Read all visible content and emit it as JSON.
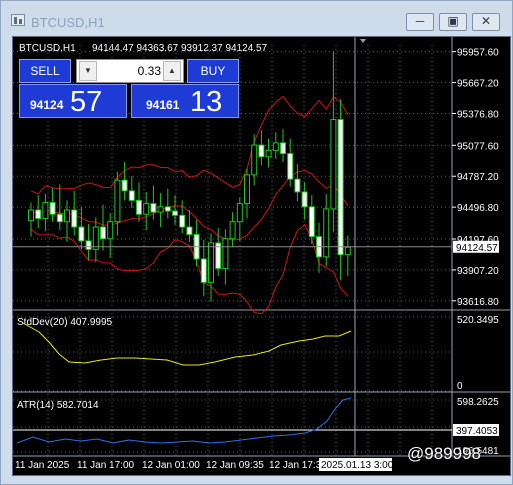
{
  "window": {
    "title": "BTCUSD,H1",
    "buttons": [
      "minimize",
      "restore",
      "close"
    ]
  },
  "chart_header": {
    "symbol": "BTCUSD,H1",
    "ohlc": "94144.47 94363.67 93912.37 94124.57"
  },
  "trade_panel": {
    "sell_label": "SELL",
    "buy_label": "BUY",
    "lot": "0.33",
    "bid_small": "94124",
    "bid_big": "57",
    "ask_small": "94161",
    "ask_big": "13"
  },
  "price_axis": {
    "labels": [
      "95957.60",
      "95667.20",
      "95376.80",
      "95077.60",
      "94787.20",
      "94496.80",
      "94197.60",
      "94124.57",
      "93907.20",
      "93616.80"
    ]
  },
  "indicators": {
    "stddev": {
      "label": "StdDev(20) 407.9995",
      "max": "520.3495",
      "min": "0"
    },
    "atr": {
      "label": "ATR(14) 582.7014",
      "max": "598.2625",
      "mid": "397.4053",
      "low": "196.5481"
    }
  },
  "time_axis": {
    "labels": [
      "11 Jan 2025",
      "11 Jan 17:00",
      "12 Jan 01:00",
      "12 Jan 09:35",
      "12 Jan 17:3",
      "2025.01.13 3:00"
    ]
  },
  "watermark": "@989998",
  "chart_data": {
    "type": "candlestick",
    "title": "BTCUSD,H1",
    "ylim": [
      93540,
      96020
    ],
    "indicators": [
      "Bollinger Bands",
      "StdDev(20)",
      "ATR(14)"
    ],
    "candles": [
      {
        "o": 94370,
        "h": 94540,
        "l": 94220,
        "c": 94470
      },
      {
        "o": 94470,
        "h": 94610,
        "l": 94300,
        "c": 94390
      },
      {
        "o": 94390,
        "h": 94620,
        "l": 94270,
        "c": 94540
      },
      {
        "o": 94540,
        "h": 94680,
        "l": 94360,
        "c": 94430
      },
      {
        "o": 94430,
        "h": 94710,
        "l": 94280,
        "c": 94360
      },
      {
        "o": 94360,
        "h": 94560,
        "l": 94170,
        "c": 94470
      },
      {
        "o": 94470,
        "h": 94650,
        "l": 94230,
        "c": 94310
      },
      {
        "o": 94310,
        "h": 94500,
        "l": 94100,
        "c": 94180
      },
      {
        "o": 94180,
        "h": 94340,
        "l": 94000,
        "c": 94100
      },
      {
        "o": 94100,
        "h": 94400,
        "l": 93980,
        "c": 94310
      },
      {
        "o": 94310,
        "h": 94520,
        "l": 94090,
        "c": 94200
      },
      {
        "o": 94200,
        "h": 94440,
        "l": 94020,
        "c": 94360
      },
      {
        "o": 94360,
        "h": 94830,
        "l": 94230,
        "c": 94750
      },
      {
        "o": 94750,
        "h": 94920,
        "l": 94560,
        "c": 94650
      },
      {
        "o": 94650,
        "h": 94790,
        "l": 94490,
        "c": 94560
      },
      {
        "o": 94560,
        "h": 94730,
        "l": 94360,
        "c": 94430
      },
      {
        "o": 94430,
        "h": 94640,
        "l": 94280,
        "c": 94530
      },
      {
        "o": 94530,
        "h": 94700,
        "l": 94380,
        "c": 94450
      },
      {
        "o": 94450,
        "h": 94630,
        "l": 94310,
        "c": 94500
      },
      {
        "o": 94500,
        "h": 94670,
        "l": 94390,
        "c": 94460
      },
      {
        "o": 94460,
        "h": 94610,
        "l": 94330,
        "c": 94420
      },
      {
        "o": 94420,
        "h": 94560,
        "l": 94250,
        "c": 94310
      },
      {
        "o": 94310,
        "h": 94470,
        "l": 94170,
        "c": 94240
      },
      {
        "o": 94240,
        "h": 94380,
        "l": 93940,
        "c": 94010
      },
      {
        "o": 94010,
        "h": 94190,
        "l": 93660,
        "c": 93790
      },
      {
        "o": 93790,
        "h": 94250,
        "l": 93610,
        "c": 94160
      },
      {
        "o": 94160,
        "h": 94300,
        "l": 93850,
        "c": 93920
      },
      {
        "o": 93920,
        "h": 94290,
        "l": 93770,
        "c": 94200
      },
      {
        "o": 94200,
        "h": 94450,
        "l": 94120,
        "c": 94360
      },
      {
        "o": 94360,
        "h": 94590,
        "l": 94180,
        "c": 94530
      },
      {
        "o": 94530,
        "h": 94860,
        "l": 94390,
        "c": 94800
      },
      {
        "o": 94800,
        "h": 95180,
        "l": 94700,
        "c": 95080
      },
      {
        "o": 95080,
        "h": 95220,
        "l": 94890,
        "c": 94970
      },
      {
        "o": 94970,
        "h": 95140,
        "l": 94870,
        "c": 95030
      },
      {
        "o": 95030,
        "h": 95200,
        "l": 94950,
        "c": 95100
      },
      {
        "o": 95100,
        "h": 95230,
        "l": 94920,
        "c": 95000
      },
      {
        "o": 95000,
        "h": 95140,
        "l": 94690,
        "c": 94760
      },
      {
        "o": 94760,
        "h": 94900,
        "l": 94550,
        "c": 94640
      },
      {
        "o": 94640,
        "h": 94730,
        "l": 94380,
        "c": 94500
      },
      {
        "o": 94500,
        "h": 94610,
        "l": 94150,
        "c": 94220
      },
      {
        "o": 94220,
        "h": 94350,
        "l": 93880,
        "c": 94030
      },
      {
        "o": 94030,
        "h": 94620,
        "l": 93940,
        "c": 94480
      },
      {
        "o": 94480,
        "h": 95960,
        "l": 94260,
        "c": 95320
      },
      {
        "o": 95320,
        "h": 95510,
        "l": 93810,
        "c": 94050
      },
      {
        "o": 94050,
        "h": 94230,
        "l": 93850,
        "c": 94120
      }
    ]
  }
}
